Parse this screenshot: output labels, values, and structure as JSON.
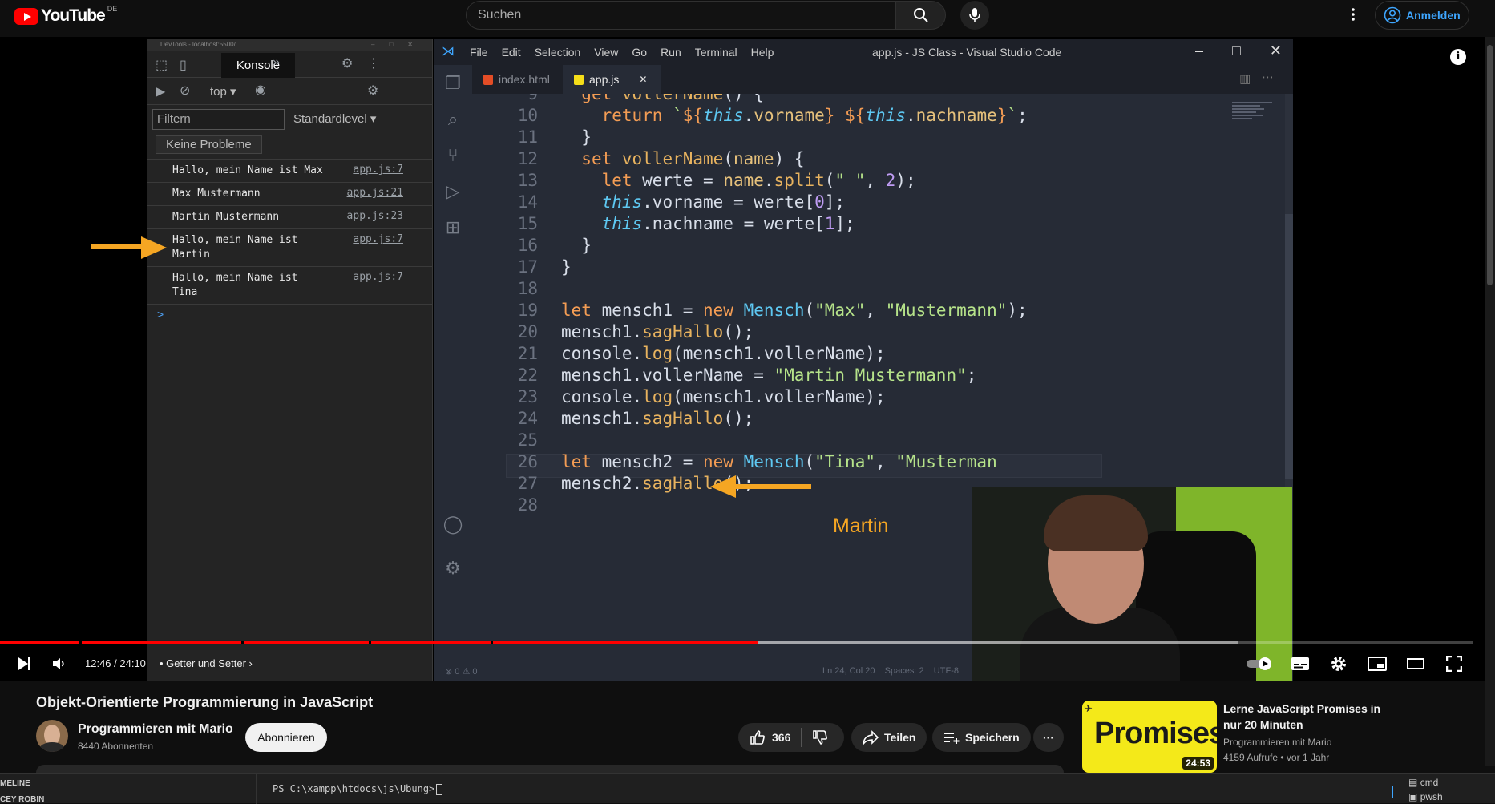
{
  "youtube": {
    "logo_text": "YouTube",
    "country_code": "DE",
    "search_placeholder": "Suchen",
    "signin_label": "Anmelden"
  },
  "devtools": {
    "window_title": "DevTools - localhost:5500/",
    "active_tab": "Konsole",
    "context": "top",
    "filter_placeholder": "Filtern",
    "level": "Standardlevel",
    "issues_label": "Keine Probleme",
    "logs": [
      {
        "msg": "Hallo, mein Name ist Max",
        "src": "app.js:7"
      },
      {
        "msg": "Max Mustermann",
        "src": "app.js:21"
      },
      {
        "msg": "Martin Mustermann",
        "src": "app.js:23"
      },
      {
        "msg": "Hallo, mein Name ist\nMartin",
        "src": "app.js:7"
      },
      {
        "msg": "Hallo, mein Name ist\nTina",
        "src": "app.js:7"
      }
    ],
    "prompt": ">"
  },
  "vscode": {
    "menu": [
      "File",
      "Edit",
      "Selection",
      "View",
      "Go",
      "Run",
      "Terminal",
      "Help"
    ],
    "title": "app.js - JS Class - Visual Studio Code",
    "tabs": [
      {
        "label": "index.html",
        "color": "#e44d26"
      },
      {
        "label": "app.js",
        "color": "#f5de19"
      }
    ],
    "tab_close": "✕",
    "status_left": "⊗ 0 ⚠ 0",
    "status_right": "Ln 24, Col 20    Spaces: 2    UTF-8",
    "code_lines": [
      {
        "n": "9"
      },
      {
        "n": "10"
      },
      {
        "n": "11"
      },
      {
        "n": "12"
      },
      {
        "n": "13"
      },
      {
        "n": "14"
      },
      {
        "n": "15"
      },
      {
        "n": "16"
      },
      {
        "n": "17"
      },
      {
        "n": "18"
      },
      {
        "n": "19"
      },
      {
        "n": "20"
      },
      {
        "n": "21"
      },
      {
        "n": "22"
      },
      {
        "n": "23"
      },
      {
        "n": "24"
      },
      {
        "n": "25"
      },
      {
        "n": "26"
      },
      {
        "n": "27"
      },
      {
        "n": "28"
      }
    ],
    "annotation": "Martin"
  },
  "player": {
    "time": "12:46 / 24:10",
    "chapter": "Getter und Setter",
    "progress_played": 0.514,
    "chapter_gaps": [
      0.054,
      0.164,
      0.25,
      0.333
    ],
    "info_icon": "i"
  },
  "video": {
    "title": "Objekt-Orientierte Programmierung in JavaScript",
    "channel": "Programmieren mit Mario",
    "subscribers": "8440 Abonnenten",
    "subscribe_label": "Abonnieren",
    "likes": "366",
    "share_label": "Teilen",
    "save_label": "Speichern",
    "more_label": "···"
  },
  "recommendation": {
    "thumb_text": "Promises",
    "duration": "24:53",
    "title": "Lerne JavaScript Promises in nur 20 Minuten",
    "channel": "Programmieren mit Mario",
    "meta": "4159 Aufrufe • vor 1 Jahr"
  },
  "terminal": {
    "left_top": "MELINE",
    "left_bottom": "CEY ROBIN",
    "prompt": "PS C:\\xampp\\htdocs\\js\\Ubung>",
    "shells": [
      "cmd",
      "pwsh"
    ]
  }
}
